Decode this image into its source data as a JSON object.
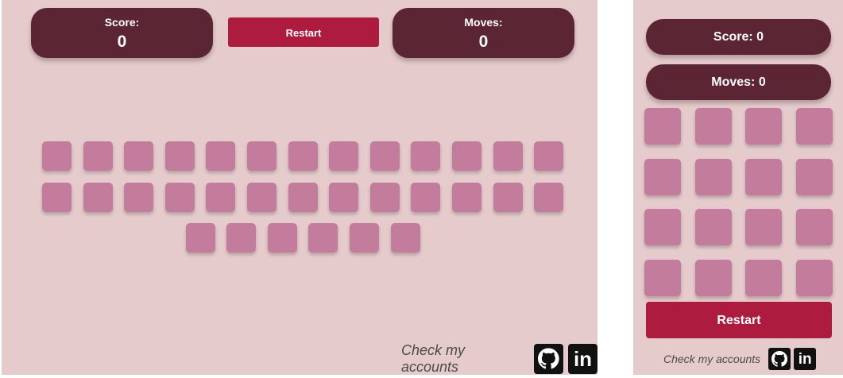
{
  "desktop": {
    "score_label": "Score:",
    "score_value": "0",
    "moves_label": "Moves:",
    "moves_value": "0",
    "restart_label": "Restart",
    "cards_count": 32,
    "footer_text": "Check my accounts"
  },
  "mobile": {
    "score_label": "Score:",
    "score_value": "0",
    "moves_label": "Moves:",
    "moves_value": "0",
    "restart_label": "Restart",
    "cards_count": 16,
    "footer_text": "Check my accounts"
  },
  "icons": {
    "github": "github-icon",
    "linkedin": "linkedin-icon",
    "linkedin_glyph": "in"
  },
  "colors": {
    "background": "#e6cbcc",
    "panel": "#5b2533",
    "restart": "#ad1c3f",
    "card": "#c37c9c"
  }
}
